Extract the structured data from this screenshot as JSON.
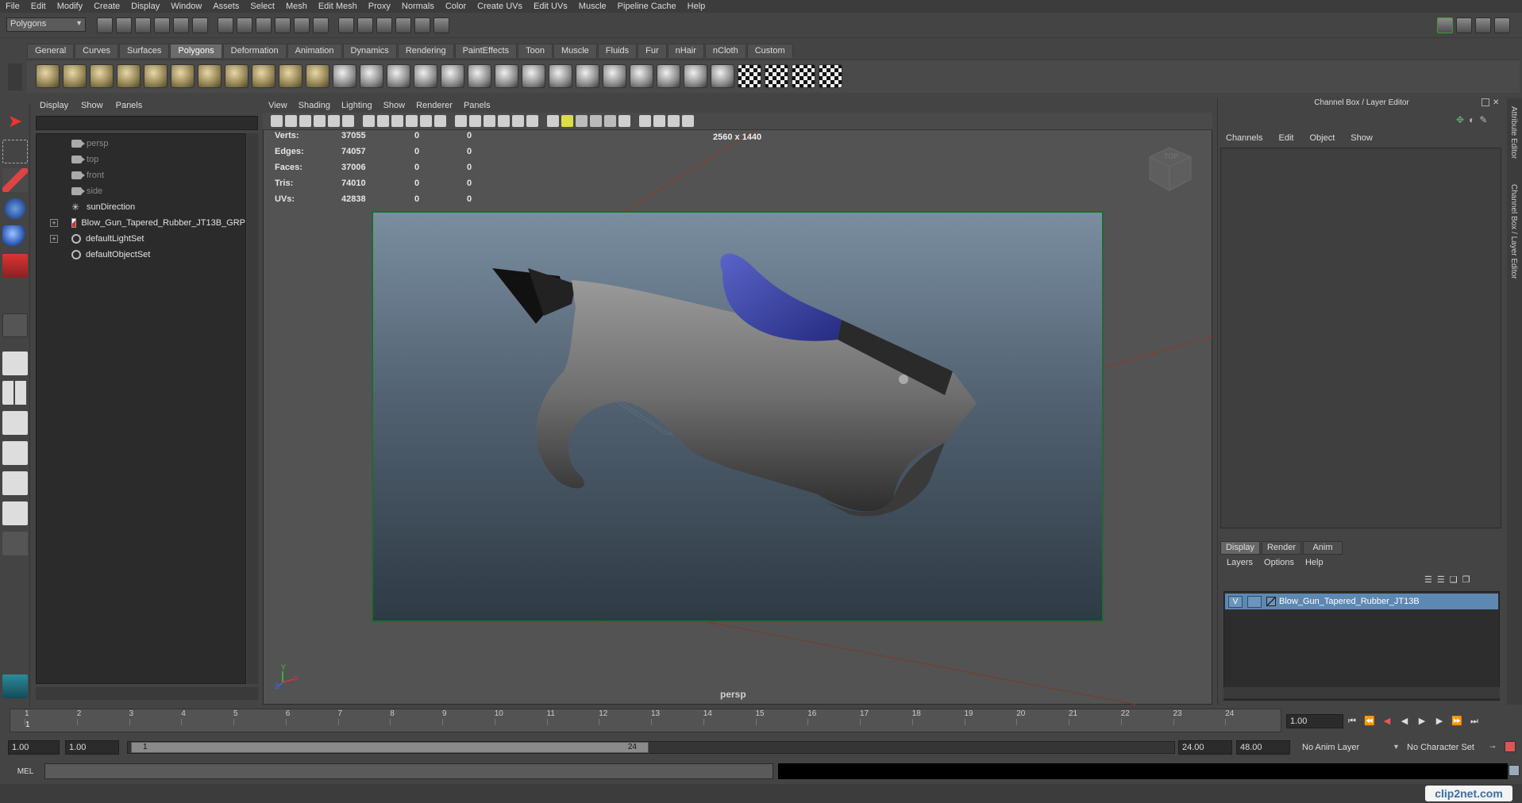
{
  "menu": [
    "File",
    "Edit",
    "Modify",
    "Create",
    "Display",
    "Window",
    "Assets",
    "Select",
    "Mesh",
    "Edit Mesh",
    "Proxy",
    "Normals",
    "Color",
    "Create UVs",
    "Edit UVs",
    "Muscle",
    "Pipeline Cache",
    "Help"
  ],
  "status": {
    "mode": "Polygons"
  },
  "shelf_tabs": [
    "General",
    "Curves",
    "Surfaces",
    "Polygons",
    "Deformation",
    "Animation",
    "Dynamics",
    "Rendering",
    "PaintEffects",
    "Toon",
    "Muscle",
    "Fluids",
    "Fur",
    "nHair",
    "nCloth",
    "Custom"
  ],
  "shelf_active": "Polygons",
  "outliner": {
    "menu": [
      "Display",
      "Show",
      "Panels"
    ],
    "items": [
      {
        "label": "persp",
        "icon": "camera-icon",
        "dim": true
      },
      {
        "label": "top",
        "icon": "camera-icon",
        "dim": true
      },
      {
        "label": "front",
        "icon": "camera-icon",
        "dim": true
      },
      {
        "label": "side",
        "icon": "camera-icon",
        "dim": true
      },
      {
        "label": "sunDirection",
        "icon": "light-icon",
        "dim": false
      },
      {
        "label": "Blow_Gun_Tapered_Rubber_JT13B_GRP",
        "icon": "group-icon",
        "dim": false,
        "expand": true
      },
      {
        "label": "defaultLightSet",
        "icon": "set-icon",
        "dim": false,
        "expand": true
      },
      {
        "label": "defaultObjectSet",
        "icon": "set-icon",
        "dim": false
      }
    ]
  },
  "viewport": {
    "menu": [
      "View",
      "Shading",
      "Lighting",
      "Show",
      "Renderer",
      "Panels"
    ],
    "hud": [
      {
        "label": "Verts:",
        "a": "37055",
        "b": "0",
        "c": "0"
      },
      {
        "label": "Edges:",
        "a": "74057",
        "b": "0",
        "c": "0"
      },
      {
        "label": "Faces:",
        "a": "37006",
        "b": "0",
        "c": "0"
      },
      {
        "label": "Tris:",
        "a": "74010",
        "b": "0",
        "c": "0"
      },
      {
        "label": "UVs:",
        "a": "42838",
        "b": "0",
        "c": "0"
      }
    ],
    "resolution": "2560 x 1440",
    "camera": "persp",
    "viewcube": "TOP",
    "axis_y": "Y",
    "axis_z": "Z",
    "axis_x": "X"
  },
  "channel_box": {
    "title": "Channel Box / Layer Editor",
    "menu": [
      "Channels",
      "Edit",
      "Object",
      "Show"
    ],
    "side_tab_1": "Attribute Editor",
    "side_tab_2": "Channel Box / Layer Editor"
  },
  "layer_editor": {
    "tabs": [
      "Display",
      "Render",
      "Anim"
    ],
    "active_tab": "Display",
    "menu": [
      "Layers",
      "Options",
      "Help"
    ],
    "layers": [
      {
        "visible": "V",
        "name": "Blow_Gun_Tapered_Rubber_JT13B"
      }
    ]
  },
  "timeline": {
    "ticks": [
      "1",
      "2",
      "3",
      "4",
      "5",
      "6",
      "7",
      "8",
      "9",
      "10",
      "11",
      "12",
      "13",
      "14",
      "15",
      "16",
      "17",
      "18",
      "19",
      "20",
      "21",
      "22",
      "23",
      "24"
    ],
    "current_frame_label": "1",
    "current_time": "1.00"
  },
  "range": {
    "start": "1.00",
    "anim_start": "1.00",
    "range_start": "1",
    "range_end": "24",
    "end": "24.00",
    "anim_end": "48.00",
    "anim_layer": "No Anim Layer",
    "character_set": "No Character Set"
  },
  "command": {
    "label": "MEL"
  },
  "watermark": "clip2net.com"
}
